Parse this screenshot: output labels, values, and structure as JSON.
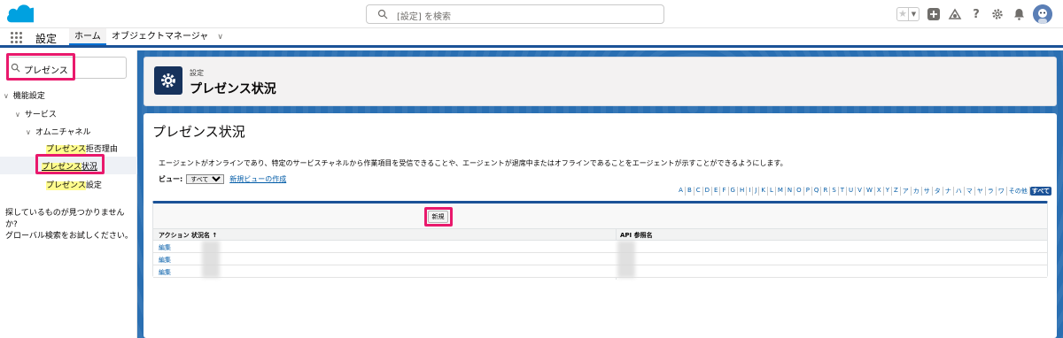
{
  "header": {
    "search_placeholder": "[設定] を検索",
    "icons": [
      "star-icon",
      "chevron-down-icon",
      "plus-icon",
      "trailhead-icon",
      "help-icon",
      "gear-icon",
      "bell-icon",
      "avatar"
    ]
  },
  "navbar": {
    "app_name": "設定",
    "tabs": [
      {
        "label": "ホーム",
        "active": true
      },
      {
        "label": "オブジェクトマネージャ",
        "active": false
      }
    ]
  },
  "sidebar": {
    "quick_find_value": "プレゼンス",
    "tree": {
      "feature_settings": "機能設定",
      "service": "サービス",
      "omni_channel": "オムニチャネル",
      "items": [
        {
          "highlight": "プレゼンス",
          "rest": "拒否理由",
          "selected": false
        },
        {
          "highlight": "プレゼンス",
          "rest": "状況",
          "selected": true
        },
        {
          "highlight": "プレゼンス",
          "rest": "設定",
          "selected": false
        }
      ]
    },
    "no_result_line1": "探しているものが見つかりませんか?",
    "no_result_line2": "グローバル検索をお試しください。"
  },
  "page_header": {
    "breadcrumb": "設定",
    "title": "プレゼンス状況"
  },
  "content": {
    "title": "プレゼンス状況",
    "description": "エージェントがオンラインであり、特定のサービスチャネルから作業項目を受信できることや、エージェントが退席中またはオフラインであることをエージェントが示すことができるようにします。",
    "view_label": "ビュー:",
    "view_selected": "すべて",
    "new_view_link": "新規ビューの作成",
    "alpha_filter": [
      "A",
      "B",
      "C",
      "D",
      "E",
      "F",
      "G",
      "H",
      "I",
      "J",
      "K",
      "L",
      "M",
      "N",
      "O",
      "P",
      "Q",
      "R",
      "S",
      "T",
      "U",
      "V",
      "W",
      "X",
      "Y",
      "Z",
      "ア",
      "カ",
      "サ",
      "タ",
      "ナ",
      "ハ",
      "マ",
      "ヤ",
      "ラ",
      "ワ",
      "その他",
      "すべて"
    ],
    "alpha_active": "すべて",
    "new_button": "新規",
    "columns": {
      "action": "アクション",
      "status_name": "状況名 ↑",
      "api_name": "API 参照名"
    },
    "rows": [
      {
        "action": "編集"
      },
      {
        "action": "編集"
      },
      {
        "action": "編集"
      }
    ]
  },
  "colors": {
    "accent": "#0070d2",
    "brand_bar": "#1b5297",
    "highlight_box": "#e9196c",
    "mark": "#fffc8e"
  }
}
